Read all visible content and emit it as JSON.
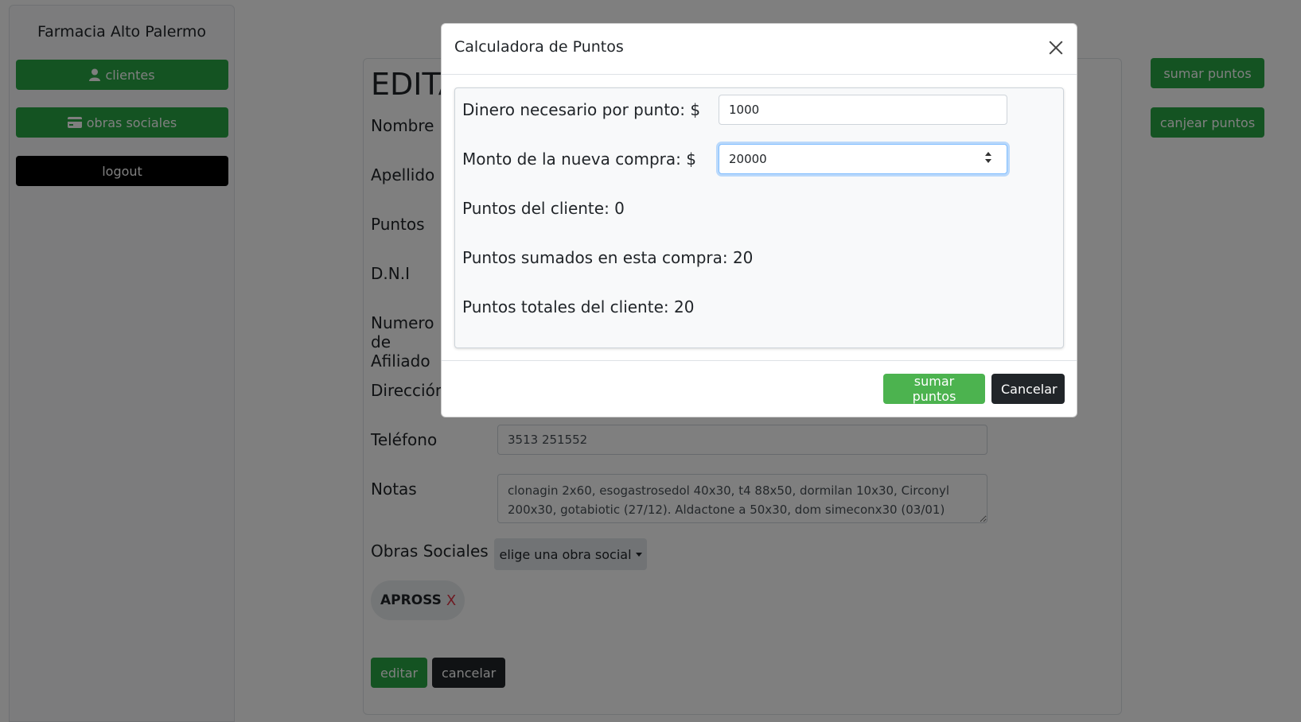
{
  "sidebar": {
    "brand": "Farmacia Alto Palermo",
    "items": [
      {
        "label": "clientes",
        "icon": "user-icon"
      },
      {
        "label": "obras sociales",
        "icon": "credit-card-icon"
      },
      {
        "label": "logout"
      }
    ]
  },
  "edit_form": {
    "title": "EDITAR",
    "labels": {
      "nombre": "Nombre",
      "apellido": "Apellido",
      "puntos": "Puntos",
      "dni": "D.N.I",
      "numero_afiliado": "Numero de Afiliado",
      "direccion": "Dirección",
      "telefono": "Teléfono",
      "notas": "Notas",
      "obras_sociales": "Obras Sociales"
    },
    "values": {
      "telefono": "3513 251552",
      "notas": "clonagin 2x60, esogastrosedol 40x30, t4 88x50, dormilan 10x30, Circonyl 200x30, gotabiotic (27/12). Aldactone a 50x30, dom simeconx30 (03/01)"
    },
    "dropdown_label": "elige una obra social",
    "chips": [
      {
        "label": "APROSS",
        "remove": "X"
      }
    ],
    "edit_button": "editar",
    "cancel_button": "cancelar"
  },
  "right_actions": {
    "add_points": "sumar puntos",
    "redeem_points": "canjear puntos"
  },
  "modal": {
    "title": "Calculadora de Puntos",
    "money_per_point_label": "Dinero necesario por punto: $",
    "money_per_point_value": "1000",
    "purchase_amount_label": "Monto de la nueva compra: $",
    "purchase_amount_value": "20000",
    "client_points": "Puntos del cliente: 0",
    "points_added": "Puntos sumados en esta compra: 20",
    "points_total": "Puntos totales del cliente: 20",
    "confirm_button": "sumar puntos",
    "cancel_button": "Cancelar"
  },
  "colors": {
    "success": "#28a745",
    "dark": "#212529",
    "danger": "#dc3545"
  }
}
